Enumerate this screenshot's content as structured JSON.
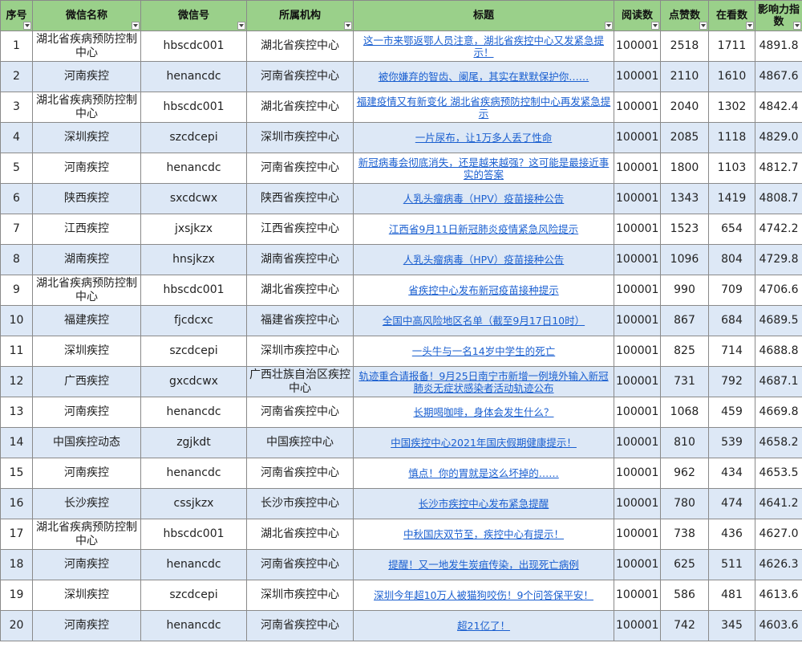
{
  "headers": {
    "no": "序号",
    "name": "微信名称",
    "id": "微信号",
    "org": "所属机构",
    "title": "标题",
    "read": "阅读数",
    "like": "点赞数",
    "watch": "在看数",
    "influence": "影响力指数"
  },
  "rows": [
    {
      "no": "1",
      "name": "湖北省疾病预防控制中心",
      "id": "hbscdc001",
      "org": "湖北省疾控中心",
      "title": "这一市来鄂返鄂人员注意，湖北省疾控中心又发紧急提示！",
      "read": "100001",
      "like": "2518",
      "watch": "1711",
      "influence": "4891.8"
    },
    {
      "no": "2",
      "name": "河南疾控",
      "id": "henancdc",
      "org": "河南省疾控中心",
      "title": "被你嫌弃的智齿、阑尾，其实在默默保护你……",
      "read": "100001",
      "like": "2110",
      "watch": "1610",
      "influence": "4867.6"
    },
    {
      "no": "3",
      "name": "湖北省疾病预防控制中心",
      "id": "hbscdc001",
      "org": "湖北省疾控中心",
      "title": "福建疫情又有新变化 湖北省疾病预防控制中心再发紧急提示",
      "read": "100001",
      "like": "2040",
      "watch": "1302",
      "influence": "4842.4"
    },
    {
      "no": "4",
      "name": "深圳疾控",
      "id": "szcdcepi",
      "org": "深圳市疾控中心",
      "title": "一片尿布，让1万多人丢了性命",
      "read": "100001",
      "like": "2085",
      "watch": "1118",
      "influence": "4829.0"
    },
    {
      "no": "5",
      "name": "河南疾控",
      "id": "henancdc",
      "org": "河南省疾控中心",
      "title": "新冠病毒会彻底消失，还是越来越强？这可能是最接近事实的答案",
      "read": "100001",
      "like": "1800",
      "watch": "1103",
      "influence": "4812.7"
    },
    {
      "no": "6",
      "name": "陕西疾控",
      "id": "sxcdcwx",
      "org": "陕西省疾控中心",
      "title": "人乳头瘤病毒（HPV）疫苗接种公告",
      "read": "100001",
      "like": "1343",
      "watch": "1419",
      "influence": "4808.7"
    },
    {
      "no": "7",
      "name": "江西疾控",
      "id": "jxsjkzx",
      "org": "江西省疾控中心",
      "title": "江西省9月11日新冠肺炎疫情紧急风险提示",
      "read": "100001",
      "like": "1523",
      "watch": "654",
      "influence": "4742.2"
    },
    {
      "no": "8",
      "name": "湖南疾控",
      "id": "hnsjkzx",
      "org": "湖南省疾控中心",
      "title": "人乳头瘤病毒（HPV）疫苗接种公告",
      "read": "100001",
      "like": "1096",
      "watch": "804",
      "influence": "4729.8"
    },
    {
      "no": "9",
      "name": "湖北省疾病预防控制中心",
      "id": "hbscdc001",
      "org": "湖北省疾控中心",
      "title": "省疾控中心发布新冠疫苗接种提示",
      "read": "100001",
      "like": "990",
      "watch": "709",
      "influence": "4706.6"
    },
    {
      "no": "10",
      "name": "福建疾控",
      "id": "fjcdcxc",
      "org": "福建省疾控中心",
      "title": "全国中高风险地区名单（截至9月17日10时）",
      "read": "100001",
      "like": "867",
      "watch": "684",
      "influence": "4689.5"
    },
    {
      "no": "11",
      "name": "深圳疾控",
      "id": "szcdcepi",
      "org": "深圳市疾控中心",
      "title": "一头牛与一名14岁中学生的死亡",
      "read": "100001",
      "like": "825",
      "watch": "714",
      "influence": "4688.8"
    },
    {
      "no": "12",
      "name": "广西疾控",
      "id": "gxcdcwx",
      "org": "广西壮族自治区疾控中心",
      "title": "轨迹重合请报备！9月25日南宁市新增一例境外输入新冠肺炎无症状感染者活动轨迹公布",
      "read": "100001",
      "like": "731",
      "watch": "792",
      "influence": "4687.1"
    },
    {
      "no": "13",
      "name": "河南疾控",
      "id": "henancdc",
      "org": "河南省疾控中心",
      "title": "长期喝咖啡，身体会发生什么？",
      "read": "100001",
      "like": "1068",
      "watch": "459",
      "influence": "4669.8"
    },
    {
      "no": "14",
      "name": "中国疾控动态",
      "id": "zgjkdt",
      "org": "中国疾控中心",
      "title": "中国疾控中心2021年国庆假期健康提示！",
      "read": "100001",
      "like": "810",
      "watch": "539",
      "influence": "4658.2"
    },
    {
      "no": "15",
      "name": "河南疾控",
      "id": "henancdc",
      "org": "河南省疾控中心",
      "title": "慎点！你的胃就是这么坏掉的……",
      "read": "100001",
      "like": "962",
      "watch": "434",
      "influence": "4653.5"
    },
    {
      "no": "16",
      "name": "长沙疾控",
      "id": "cssjkzx",
      "org": "长沙市疾控中心",
      "title": "长沙市疾控中心发布紧急提醒",
      "read": "100001",
      "like": "780",
      "watch": "474",
      "influence": "4641.2"
    },
    {
      "no": "17",
      "name": "湖北省疾病预防控制中心",
      "id": "hbscdc001",
      "org": "湖北省疾控中心",
      "title": "中秋国庆双节至，疾控中心有提示！",
      "read": "100001",
      "like": "738",
      "watch": "436",
      "influence": "4627.0"
    },
    {
      "no": "18",
      "name": "河南疾控",
      "id": "henancdc",
      "org": "河南省疾控中心",
      "title": "提醒！又一地发生炭疽传染，出现死亡病例",
      "read": "100001",
      "like": "625",
      "watch": "511",
      "influence": "4626.3"
    },
    {
      "no": "19",
      "name": "深圳疾控",
      "id": "szcdcepi",
      "org": "深圳市疾控中心",
      "title": "深圳今年超10万人被猫狗咬伤！9个问答保平安！",
      "read": "100001",
      "like": "586",
      "watch": "481",
      "influence": "4613.6"
    },
    {
      "no": "20",
      "name": "河南疾控",
      "id": "henancdc",
      "org": "河南省疾控中心",
      "title": "超21亿了！",
      "read": "100001",
      "like": "742",
      "watch": "345",
      "influence": "4603.6"
    }
  ]
}
